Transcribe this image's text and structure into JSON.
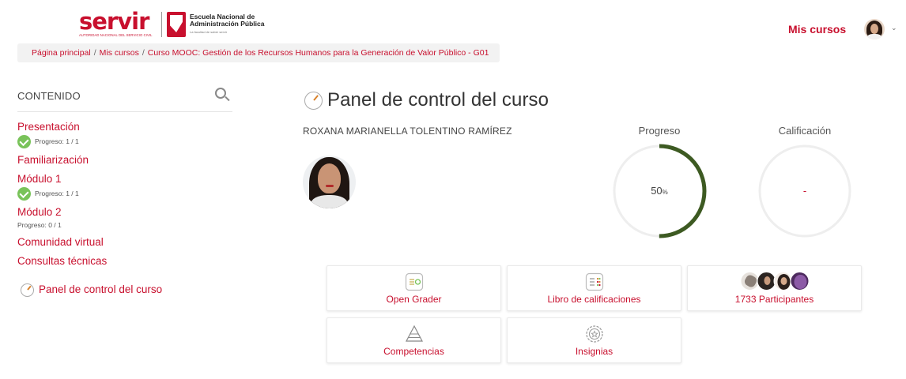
{
  "header": {
    "logo_primary": "servir",
    "logo_primary_sub": "AUTORIDAD NACIONAL DEL SERVICIO CIVIL",
    "logo_secondary_line1": "Escuela Nacional de",
    "logo_secondary_line2": "Administración Pública",
    "logo_secondary_tagline": "La facultad de saber servir",
    "nav_link": "Mis cursos",
    "caret": "⌄"
  },
  "breadcrumb": {
    "items": [
      "Página principal",
      "Mis cursos",
      "Curso MOOC: Gestión de los Recursos Humanos para la Generación de Valor Público - G01"
    ],
    "separator": "/"
  },
  "sidebar": {
    "title": "CONTENIDO",
    "items": [
      {
        "label": "Presentación",
        "progress": "Progreso: 1 / 1",
        "completed": true
      },
      {
        "label": "Familiarización"
      },
      {
        "label": "Módulo 1",
        "progress": "Progreso: 1 / 1",
        "completed": true
      },
      {
        "label": "Módulo 2",
        "progress": "Progreso: 0 / 1",
        "completed": false
      },
      {
        "label": "Comunidad virtual"
      },
      {
        "label": "Consultas técnicas"
      }
    ],
    "dashboard_link": "Panel de control del curso"
  },
  "main": {
    "title": "Panel de control del curso",
    "user_name": "ROXANA MARIANELLA TOLENTINO RAMÍREZ",
    "progress": {
      "label": "Progreso",
      "value": "50",
      "unit": "%",
      "fraction": 0.5
    },
    "grade": {
      "label": "Calificación",
      "value": "-"
    },
    "cards": [
      {
        "label": "Open Grader",
        "icon": "open-grader-icon"
      },
      {
        "label": "Libro de calificaciones",
        "icon": "gradebook-icon"
      },
      {
        "label": "1733 Participantes",
        "icon": "participants-avatars"
      },
      {
        "label": "Competencias",
        "icon": "pyramid-icon"
      },
      {
        "label": "Insignias",
        "icon": "badge-icon"
      }
    ]
  },
  "colors": {
    "accent": "#c8102e",
    "progress_ring": "#3d5a22",
    "ring_track": "#eeeeee",
    "check": "#79c35a"
  }
}
